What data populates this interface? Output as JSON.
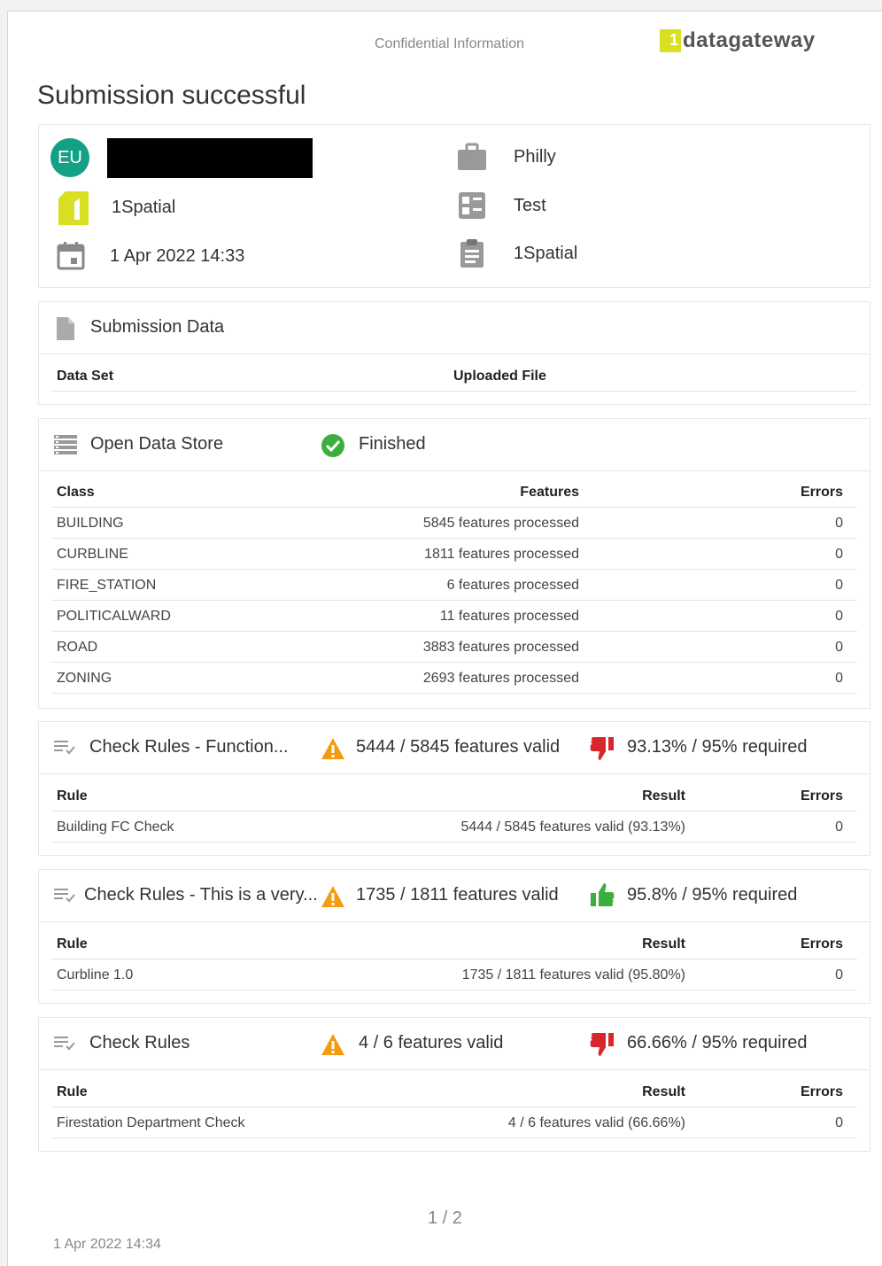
{
  "header": {
    "confidential": "Confidential Information",
    "logo_mark": "1",
    "logo_text": "datagateway",
    "page_title": "Submission successful"
  },
  "summary": {
    "avatar_initials": "EU",
    "organisation": "1Spatial",
    "date": "1 Apr 2022 14:33",
    "project": "Philly",
    "type": "Test",
    "owner": "1Spatial"
  },
  "submission_data": {
    "title": "Submission Data",
    "col_dataset": "Data Set",
    "col_file": "Uploaded File"
  },
  "open_data_store": {
    "title": "Open Data Store",
    "status": "Finished",
    "columns": [
      "Class",
      "Features",
      "Errors"
    ],
    "rows": [
      {
        "cls": "BUILDING",
        "features": "5845 features processed",
        "errors": "0"
      },
      {
        "cls": "CURBLINE",
        "features": "1811 features processed",
        "errors": "0"
      },
      {
        "cls": "FIRE_STATION",
        "features": "6 features processed",
        "errors": "0"
      },
      {
        "cls": "POLITICALWARD",
        "features": "11 features processed",
        "errors": "0"
      },
      {
        "cls": "ROAD",
        "features": "3883 features processed",
        "errors": "0"
      },
      {
        "cls": "ZONING",
        "features": "2693 features processed",
        "errors": "0"
      }
    ]
  },
  "check_rules": [
    {
      "title": "Check Rules - Function...",
      "valid": "5444 / 5845 features valid",
      "pass": false,
      "required": "93.13% / 95% required",
      "columns": [
        "Rule",
        "Result",
        "Errors"
      ],
      "rule": "Building FC Check",
      "result": "5444 / 5845 features valid (93.13%)",
      "errors": "0"
    },
    {
      "title": "Check Rules - This is a very...",
      "valid": "1735 / 1811 features valid",
      "pass": true,
      "required": "95.8% / 95% required",
      "columns": [
        "Rule",
        "Result",
        "Errors"
      ],
      "rule": "Curbline 1.0",
      "result": "1735 / 1811 features valid (95.80%)",
      "errors": "0"
    },
    {
      "title": "Check Rules",
      "valid": "4 / 6 features valid",
      "pass": false,
      "required": "66.66% / 95% required",
      "columns": [
        "Rule",
        "Result",
        "Errors"
      ],
      "rule": "Firestation Department Check",
      "result": "4 / 6 features valid (66.66%)",
      "errors": "0"
    }
  ],
  "footer": {
    "page_number": "1 / 2",
    "printed_date": "1 Apr 2022 14:34"
  },
  "colors": {
    "teal": "#14a085",
    "logo_yellow": "#d9e021",
    "warning": "#f39c12",
    "fail_red": "#d9262c",
    "pass_green": "#3cae3c"
  }
}
